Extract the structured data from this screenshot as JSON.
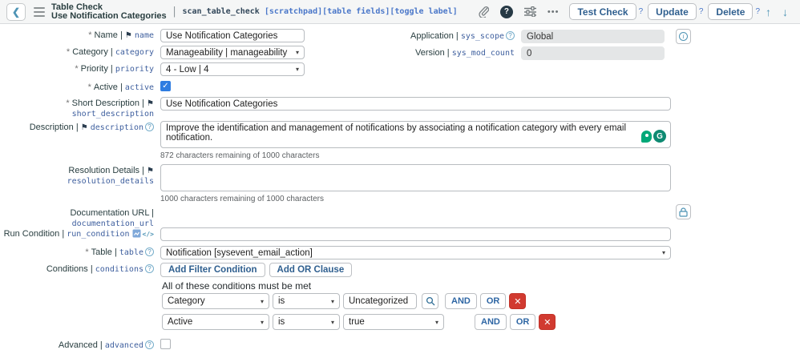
{
  "icons": {
    "back": "❮",
    "flag": "⚑",
    "caret": "▾",
    "check": "✓",
    "close": "✕",
    "up": "↑",
    "down": "↓",
    "more": "•••",
    "help": "?",
    "info": "i",
    "code": "</>",
    "grammarly": "G"
  },
  "header": {
    "title_line1": "Table Check",
    "title_line2": "Use Notification Categories",
    "separator": "|",
    "record_name": "scan_table_check",
    "record_tags": "[scratchpad][table fields][toggle label]",
    "test_check_label": "Test Check",
    "update_label": "Update",
    "delete_label": "Delete",
    "help_suffix": "?"
  },
  "fields": {
    "name": {
      "label": "Name",
      "field": "name",
      "value": "Use Notification Categories"
    },
    "application": {
      "label": "Application",
      "field": "sys_scope",
      "value": "Global"
    },
    "category": {
      "label": "Category",
      "field": "category",
      "value": "Manageability | manageability"
    },
    "version": {
      "label": "Version",
      "field": "sys_mod_count",
      "value": "0"
    },
    "priority": {
      "label": "Priority",
      "field": "priority",
      "value": "4 - Low | 4"
    },
    "active": {
      "label": "Active",
      "field": "active"
    },
    "short_description": {
      "label": "Short Description",
      "field": "short_description",
      "value": "Use Notification Categories"
    },
    "description": {
      "label": "Description",
      "field": "description",
      "value": "Improve the identification and management of notifications by associating a notification category with every email notification.",
      "counter": "872 characters remaining of 1000 characters"
    },
    "resolution_details": {
      "label": "Resolution Details",
      "field": "resolution_details",
      "value": "",
      "counter": "1000 characters remaining of 1000 characters"
    },
    "documentation_url": {
      "label": "Documentation URL",
      "field": "documentation_url"
    },
    "run_condition": {
      "label": "Run Condition",
      "field": "run_condition",
      "value": ""
    },
    "table": {
      "label": "Table",
      "field": "table",
      "value": "Notification [sysevent_email_action]"
    },
    "conditions": {
      "label": "Conditions",
      "field": "conditions",
      "add_filter_label": "Add Filter Condition",
      "add_or_label": "Add OR Clause",
      "note": "All of these conditions must be met",
      "rows": [
        {
          "field": "Category",
          "operator": "is",
          "value": "Uncategorized",
          "and_label": "AND",
          "or_label": "OR"
        },
        {
          "field": "Active",
          "operator": "is",
          "value": "true",
          "and_label": "AND",
          "or_label": "OR"
        }
      ]
    },
    "advanced": {
      "label": "Advanced",
      "field": "advanced"
    }
  }
}
